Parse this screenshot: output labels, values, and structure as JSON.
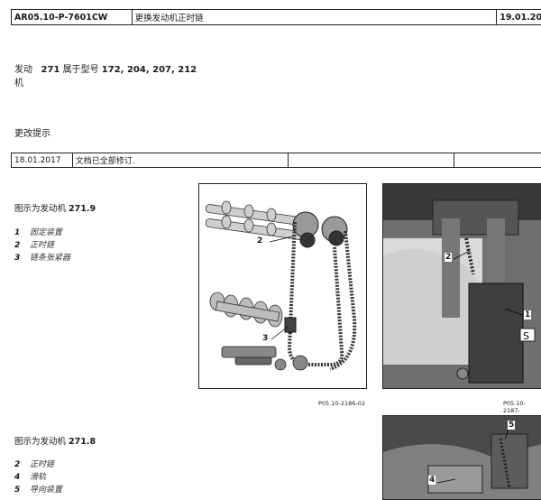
{
  "header": {
    "doc_id": "AR05.10-P-7601CW",
    "title": "更换发动机正时链",
    "date": "19.01.20"
  },
  "applies_to": {
    "prefix": "发动",
    "engine": "271",
    "middle": "属于型号",
    "models": "172, 204, 207, 212",
    "line2": "机"
  },
  "changes": {
    "title": "更改提示",
    "row": {
      "date": "18.01.2017",
      "text": "文档已全部修订."
    }
  },
  "section1": {
    "title_prefix": "图示为发动机",
    "title_engine": "271.9",
    "legend": [
      {
        "num": "1",
        "text": "固定装置"
      },
      {
        "num": "2",
        "text": "正时链"
      },
      {
        "num": "3",
        "text": "链条张紧器"
      }
    ],
    "fig1_caption": "P05.10-2186-02",
    "fig1_callouts": [
      "2",
      "3"
    ],
    "fig2_caption": "P05.10-2187-",
    "fig2_callouts": [
      "2",
      "1"
    ]
  },
  "section2": {
    "title_prefix": "图示为发动机",
    "title_engine": "271.8",
    "legend": [
      {
        "num": "2",
        "text": "正时链"
      },
      {
        "num": "4",
        "text": "滑轨"
      },
      {
        "num": "5",
        "text": "导向装置"
      }
    ],
    "fig3_callouts": [
      "5",
      "4"
    ]
  }
}
